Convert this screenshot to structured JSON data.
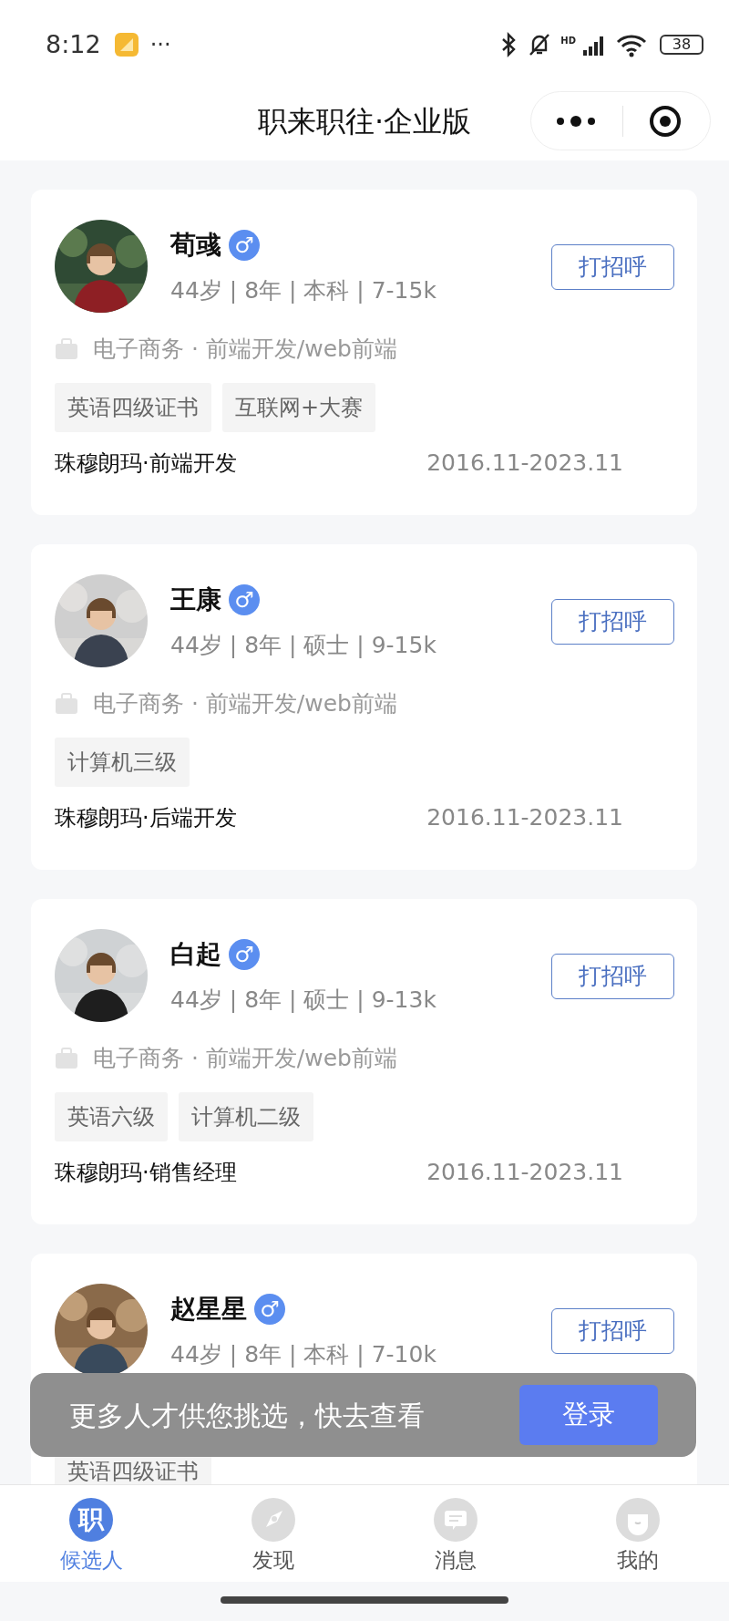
{
  "status_bar": {
    "time": "8:12",
    "more": "···",
    "battery": "38",
    "network": "HD"
  },
  "header": {
    "title": "职来职往·企业版"
  },
  "candidates": [
    {
      "name": "荀彧",
      "gender": "♂",
      "meta": "44岁 | 8年 | 本科 | 7-15k",
      "industry": "电子商务 · 前端开发/web前端",
      "tags": [
        "英语四级证书",
        "互联网+大赛"
      ],
      "company": "珠穆朗玛·前端开发",
      "period": "2016.11-2023.11",
      "button": "打招呼"
    },
    {
      "name": "王康",
      "gender": "♂",
      "meta": "44岁 | 8年 | 硕士 | 9-15k",
      "industry": "电子商务 · 前端开发/web前端",
      "tags": [
        "计算机三级"
      ],
      "company": "珠穆朗玛·后端开发",
      "period": "2016.11-2023.11",
      "button": "打招呼"
    },
    {
      "name": "白起",
      "gender": "♂",
      "meta": "44岁 | 8年 | 硕士 | 9-13k",
      "industry": "电子商务 · 前端开发/web前端",
      "tags": [
        "英语六级",
        "计算机二级"
      ],
      "company": "珠穆朗玛·销售经理",
      "period": "2016.11-2023.11",
      "button": "打招呼"
    },
    {
      "name": "赵星星",
      "gender": "♂",
      "meta": "44岁 | 8年 | 本科 | 7-10k",
      "tags": [
        "英语四级证书"
      ],
      "button": "打招呼"
    }
  ],
  "toast": {
    "message": "更多人才供您挑选，快去查看",
    "button": "登录"
  },
  "tabs": [
    {
      "label": "候选人",
      "icon_text": "职",
      "selected": true
    },
    {
      "label": "发现",
      "selected": false
    },
    {
      "label": "消息",
      "selected": false
    },
    {
      "label": "我的",
      "selected": false
    }
  ]
}
